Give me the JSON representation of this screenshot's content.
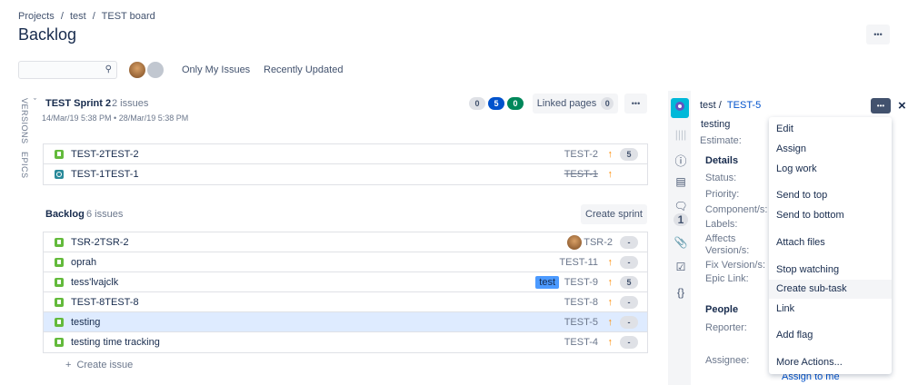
{
  "breadcrumb": [
    "Projects",
    "test",
    "TEST board"
  ],
  "breadcrumb_sep": "/",
  "page_title": "Backlog",
  "header_more": "•••",
  "search": {
    "placeholder": "",
    "icon": "search-icon"
  },
  "quick_filters": [
    "Only My Issues",
    "Recently Updated"
  ],
  "side_tabs": [
    "VERSIONS",
    "EPICS"
  ],
  "sprint": {
    "name": "TEST Sprint 2",
    "count": "2 issues",
    "dates": "14/Mar/19 5:38 PM • 28/Mar/19 5:38 PM",
    "badges": [
      {
        "value": "0",
        "color": "#dfe1e6"
      },
      {
        "value": "5",
        "color": "#0052cc"
      },
      {
        "value": "0",
        "color": "#00875a"
      }
    ],
    "linked_pages_label": "Linked pages",
    "linked_pages_count": "0",
    "more": "•••",
    "issues": [
      {
        "summary": "TEST-2TEST-2",
        "key": "TEST-2",
        "type": "story",
        "priority": "↑",
        "estimate": "5",
        "done": false
      },
      {
        "summary": "TEST-1TEST-1",
        "key": "TEST-1",
        "type": "task",
        "priority": "↑",
        "estimate": "",
        "done": true
      }
    ]
  },
  "backlog": {
    "name": "Backlog",
    "count": "6 issues",
    "create_sprint": "Create sprint",
    "create_issue": "Create issue",
    "create_issue_icon": "+",
    "issues": [
      {
        "summary": "TSR-2TSR-2",
        "key": "TSR-2",
        "priority": "",
        "estimate": "-",
        "avatar": true,
        "label": ""
      },
      {
        "summary": "oprah",
        "key": "TEST-11",
        "priority": "↑",
        "estimate": "-",
        "label": ""
      },
      {
        "summary": "tess'lvajclk",
        "key": "TEST-9",
        "priority": "↑",
        "estimate": "5",
        "label": "test"
      },
      {
        "summary": "TEST-8TEST-8",
        "key": "TEST-8",
        "priority": "↑",
        "estimate": "-",
        "label": ""
      },
      {
        "summary": "testing",
        "key": "TEST-5",
        "priority": "↑",
        "estimate": "-",
        "label": "",
        "selected": true
      },
      {
        "summary": "testing time tracking",
        "key": "TEST-4",
        "priority": "↑",
        "estimate": "-",
        "label": ""
      }
    ]
  },
  "detail": {
    "project": "test",
    "sep": "/",
    "key": "TEST-5",
    "summary": "testing",
    "estimate_label": "Estimate:",
    "details_heading": "Details",
    "fields": [
      "Status:",
      "Priority:",
      "Component/s:",
      "Labels:",
      "Affects",
      "Version/s:",
      "Fix Version/s:",
      "Epic Link:"
    ],
    "people_heading": "People",
    "reporter_label": "Reporter:",
    "assignee_label": "Assignee:",
    "assign_to_me": "Assign to me",
    "comment_count": "1",
    "more": "•••",
    "close": "×"
  },
  "actions_menu": [
    "Edit",
    "Assign",
    "Log work",
    "Send to top",
    "Send to bottom",
    "Attach files",
    "Stop watching",
    "Create sub-task",
    "Link",
    "Add flag",
    "More Actions..."
  ],
  "colors": {
    "accent": "#0052cc",
    "selected_row": "#deebff",
    "story": "#63ba3c",
    "priority": "#ff8b00",
    "label": "#4c9aff"
  }
}
